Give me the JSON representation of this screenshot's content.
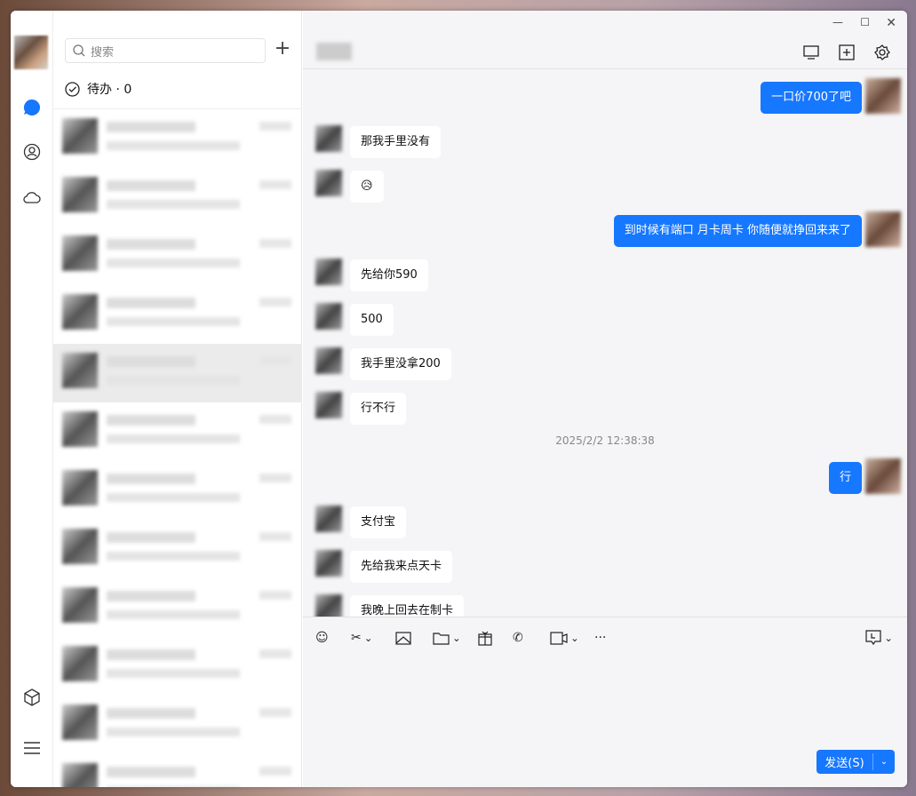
{
  "search": {
    "placeholder": "搜索"
  },
  "todo": {
    "label": "待办 · 0"
  },
  "contacts_count": 12,
  "messages": [
    {
      "dir": "sent",
      "text": "一口价700了吧"
    },
    {
      "dir": "recv",
      "text": "那我手里没有"
    },
    {
      "dir": "recv",
      "text": "😥"
    },
    {
      "dir": "sent",
      "text": "到时候有端口  月卡周卡 你随便就挣回来来了"
    },
    {
      "dir": "recv",
      "text": "先给你590"
    },
    {
      "dir": "recv",
      "text": "500"
    },
    {
      "dir": "recv",
      "text": "我手里没拿200"
    },
    {
      "dir": "recv",
      "text": "行不行"
    },
    {
      "dir": "time",
      "text": "2025/2/2 12:38:38"
    },
    {
      "dir": "sent",
      "text": "行"
    },
    {
      "dir": "recv",
      "text": "支付宝"
    },
    {
      "dir": "recv",
      "text": "先给我来点天卡"
    },
    {
      "dir": "recv",
      "text": "我晚上回去在制卡"
    }
  ],
  "send": {
    "label": "发送(S)"
  },
  "colors": {
    "accent": "#1677ff"
  }
}
